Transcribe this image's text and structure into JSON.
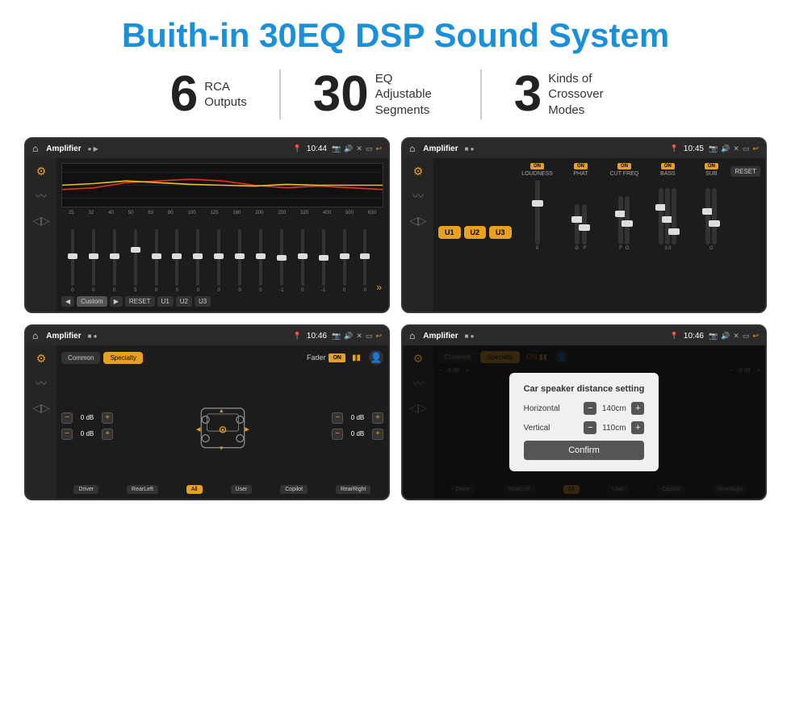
{
  "title": "Buith-in 30EQ DSP Sound System",
  "stats": [
    {
      "number": "6",
      "line1": "RCA",
      "line2": "Outputs"
    },
    {
      "number": "30",
      "line1": "EQ Adjustable",
      "line2": "Segments"
    },
    {
      "number": "3",
      "line1": "Kinds of",
      "line2": "Crossover Modes"
    }
  ],
  "screens": [
    {
      "id": "screen1",
      "statusBar": {
        "appTitle": "Amplifier",
        "dots": "● ▶",
        "time": "10:44"
      },
      "type": "eq"
    },
    {
      "id": "screen2",
      "statusBar": {
        "appTitle": "Amplifier",
        "dots": "■ ●",
        "time": "10:45"
      },
      "type": "amp"
    },
    {
      "id": "screen3",
      "statusBar": {
        "appTitle": "Amplifier",
        "dots": "■ ●",
        "time": "10:46"
      },
      "type": "fader"
    },
    {
      "id": "screen4",
      "statusBar": {
        "appTitle": "Amplifier",
        "dots": "■ ●",
        "time": "10:46"
      },
      "type": "fader-dialog",
      "dialog": {
        "title": "Car speaker distance setting",
        "horizontal": {
          "label": "Horizontal",
          "value": "140cm"
        },
        "vertical": {
          "label": "Vertical",
          "value": "110cm"
        },
        "confirmLabel": "Confirm"
      }
    }
  ],
  "eq": {
    "freqs": [
      "25",
      "32",
      "40",
      "50",
      "63",
      "80",
      "100",
      "125",
      "160",
      "200",
      "250",
      "320",
      "400",
      "500",
      "630"
    ],
    "values": [
      "0",
      "0",
      "0",
      "5",
      "0",
      "0",
      "0",
      "0",
      "0",
      "0",
      "-1",
      "0",
      "-1",
      "0",
      "0"
    ],
    "bottomBtns": [
      "◀",
      "Custom",
      "▶",
      "RESET",
      "U1",
      "U2",
      "U3"
    ]
  },
  "amp": {
    "presets": [
      "U1",
      "U2",
      "U3"
    ],
    "resetBtn": "RESET",
    "channels": [
      {
        "label": "LOUDNESS",
        "on": true
      },
      {
        "label": "PHAT",
        "on": true
      },
      {
        "label": "CUT FREQ",
        "on": true
      },
      {
        "label": "BASS",
        "on": true
      },
      {
        "label": "SUB",
        "on": true
      }
    ]
  },
  "fader": {
    "tabs": [
      "Common",
      "Specialty"
    ],
    "activeTab": "Specialty",
    "faderLabel": "Fader",
    "onLabel": "ON",
    "volRows": [
      {
        "label": "0 dB"
      },
      {
        "label": "0 dB"
      },
      {
        "label": "0 dB"
      },
      {
        "label": "0 dB"
      }
    ],
    "bottomBtns": [
      "Driver",
      "RearLeft",
      "All",
      "User",
      "Copilot",
      "RearRight"
    ]
  }
}
